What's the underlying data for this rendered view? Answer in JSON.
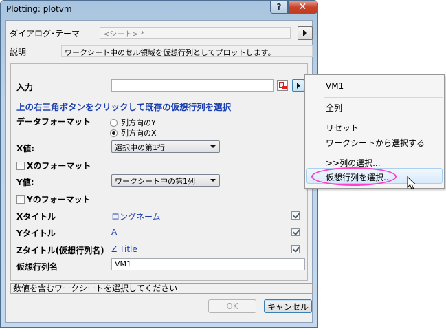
{
  "window": {
    "title": "Plotting: plotvm",
    "help_glyph": "?",
    "close_glyph": "✕"
  },
  "header": {
    "theme_label": "ダイアログ･テーマ",
    "theme_value": "<シート> *",
    "desc_label": "説明",
    "desc_value": "ワークシート中のセル領域を仮想行列としてプロットします。"
  },
  "form": {
    "input_label": "入力",
    "input_value": "",
    "hint": "上の右三角ボタンをクリックして既存の仮想行列を選択",
    "data_format_label": "データフォーマット",
    "radio_y_label": "列方向のY",
    "radio_x_label": "列方向のX",
    "radio_selected": "x",
    "x_value_label": "X値:",
    "x_value": "選択中の第1行",
    "x_format_label": "Xのフォーマット",
    "y_value_label": "Y値:",
    "y_value": "ワークシート中の第1列",
    "y_format_label": "Yのフォーマット",
    "x_title_label": "Xタイトル",
    "x_title_value": "ロングネーム",
    "y_title_label": "Yタイトル",
    "y_title_value": "A",
    "z_title_label": "Zタイトル(仮想行列名)",
    "z_title_value": "Z Title",
    "vm_name_label": "仮想行列名",
    "vm_name_value": "VM1"
  },
  "status": "数値を含むワークシートを選択してください",
  "buttons": {
    "ok": "OK",
    "cancel": "キャンセル"
  },
  "menu": {
    "items": [
      "VM1",
      "全列",
      "リセット",
      "ワークシートから選択する",
      ">>列の選択...",
      "仮想行列を選択..."
    ],
    "highlighted": 5
  },
  "colors": {
    "hint_blue": "#1a3fb0",
    "highlight_ellipse": "#ff3fd0"
  }
}
